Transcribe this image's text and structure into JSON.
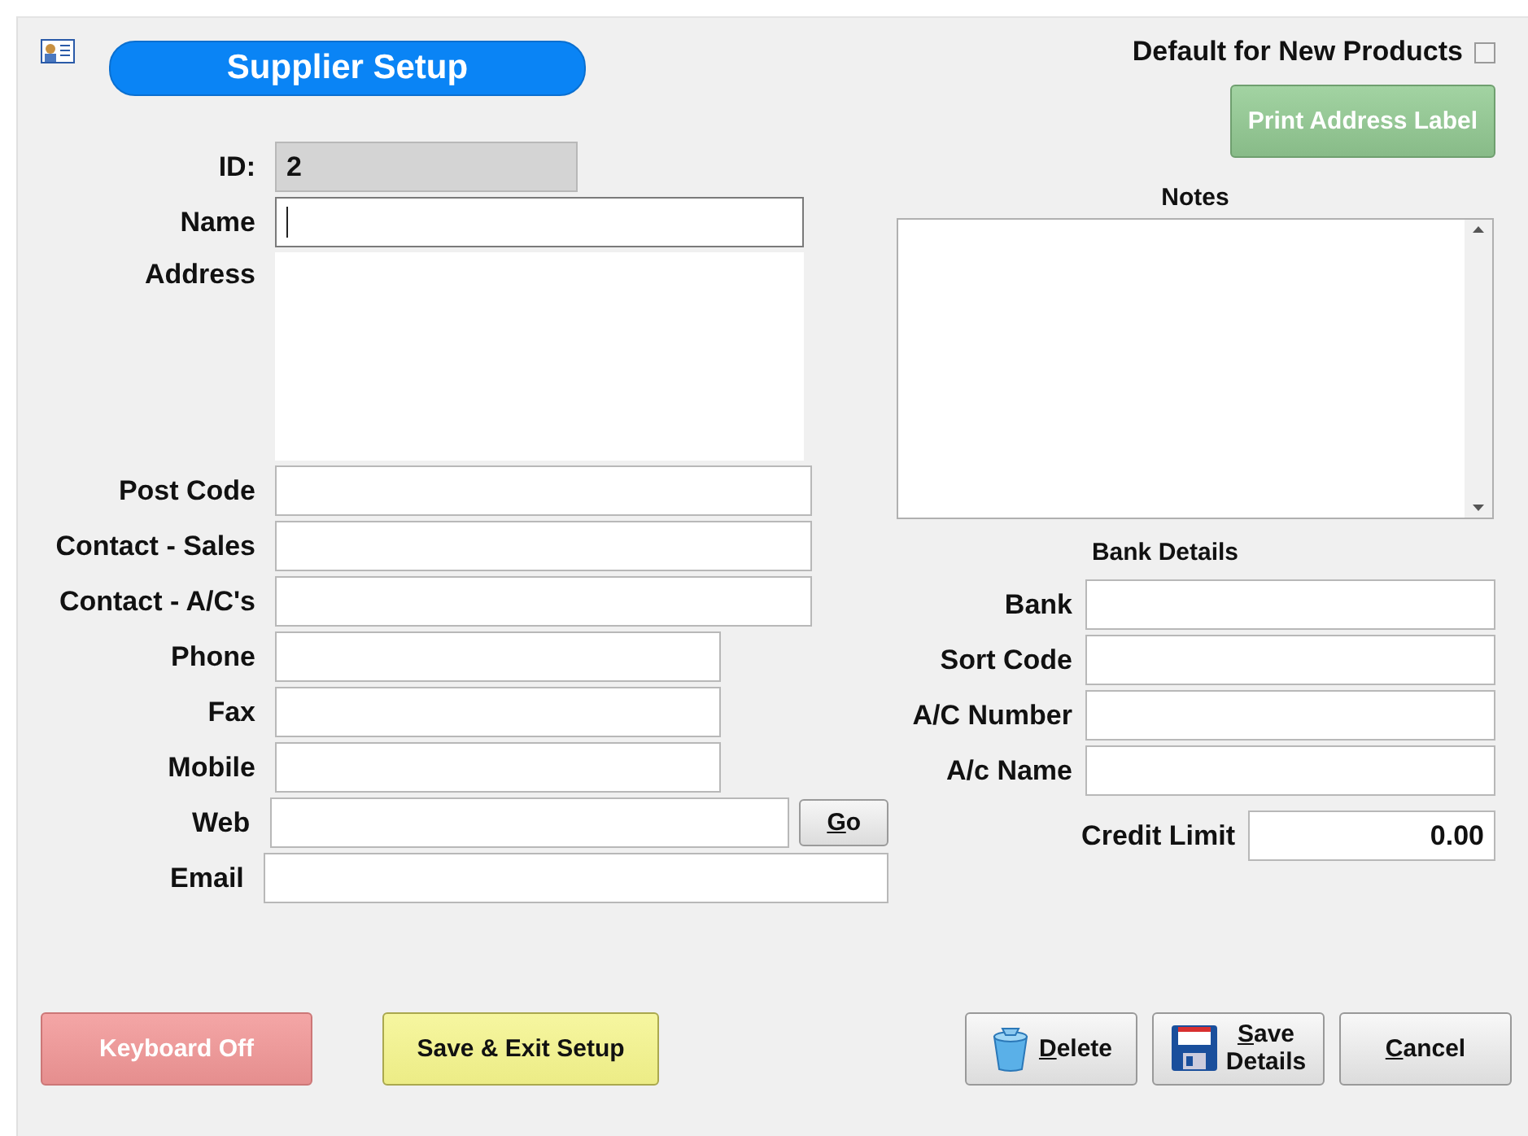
{
  "header": {
    "title": "Supplier Setup"
  },
  "default_for_new_products": {
    "label": "Default for New Products",
    "checked": false
  },
  "print_button": {
    "label": "Print Address Label"
  },
  "fields": [
    {
      "kind": "id",
      "label": "ID:",
      "value": "2",
      "focused": false
    },
    {
      "kind": "name",
      "label": "Name",
      "focused": true
    },
    {
      "kind": "address",
      "label": "Address",
      "focused": false
    },
    {
      "kind": "wide",
      "label": "Post Code",
      "focused": false
    },
    {
      "kind": "wide",
      "label": "Contact - Sales",
      "focused": false
    },
    {
      "kind": "wide",
      "label": "Contact - A/C's",
      "focused": false
    },
    {
      "kind": "short",
      "label": "Phone",
      "focused": false
    },
    {
      "kind": "short",
      "label": "Fax",
      "focused": false
    },
    {
      "kind": "short",
      "label": "Mobile",
      "focused": false
    },
    {
      "kind": "web",
      "label": "Web",
      "focused": false,
      "button": {
        "label": "Go",
        "mnemonic": true
      }
    },
    {
      "kind": "email",
      "label": "Email",
      "focused": false
    }
  ],
  "notes": {
    "label": "Notes"
  },
  "bank": {
    "title": "Bank Details",
    "fields": [
      {
        "label": "Bank"
      },
      {
        "label": "Sort Code"
      },
      {
        "label": "A/C Number"
      },
      {
        "label": "A/c Name"
      }
    ]
  },
  "credit_limit": {
    "label": "Credit Limit",
    "value": "0.00"
  },
  "buttons": [
    {
      "kind": "keyboard",
      "label": "Keyboard Off",
      "mnemonic": false
    },
    {
      "kind": "save_exit",
      "label": "Save & Exit Setup",
      "mnemonic": false
    },
    {
      "kind": "delete",
      "label": "Delete",
      "mnemonic": true
    },
    {
      "kind": "save",
      "lines": [
        "Save",
        "Details"
      ],
      "mnemonic": true
    },
    {
      "kind": "cancel",
      "label": "Cancel",
      "mnemonic": true
    }
  ]
}
